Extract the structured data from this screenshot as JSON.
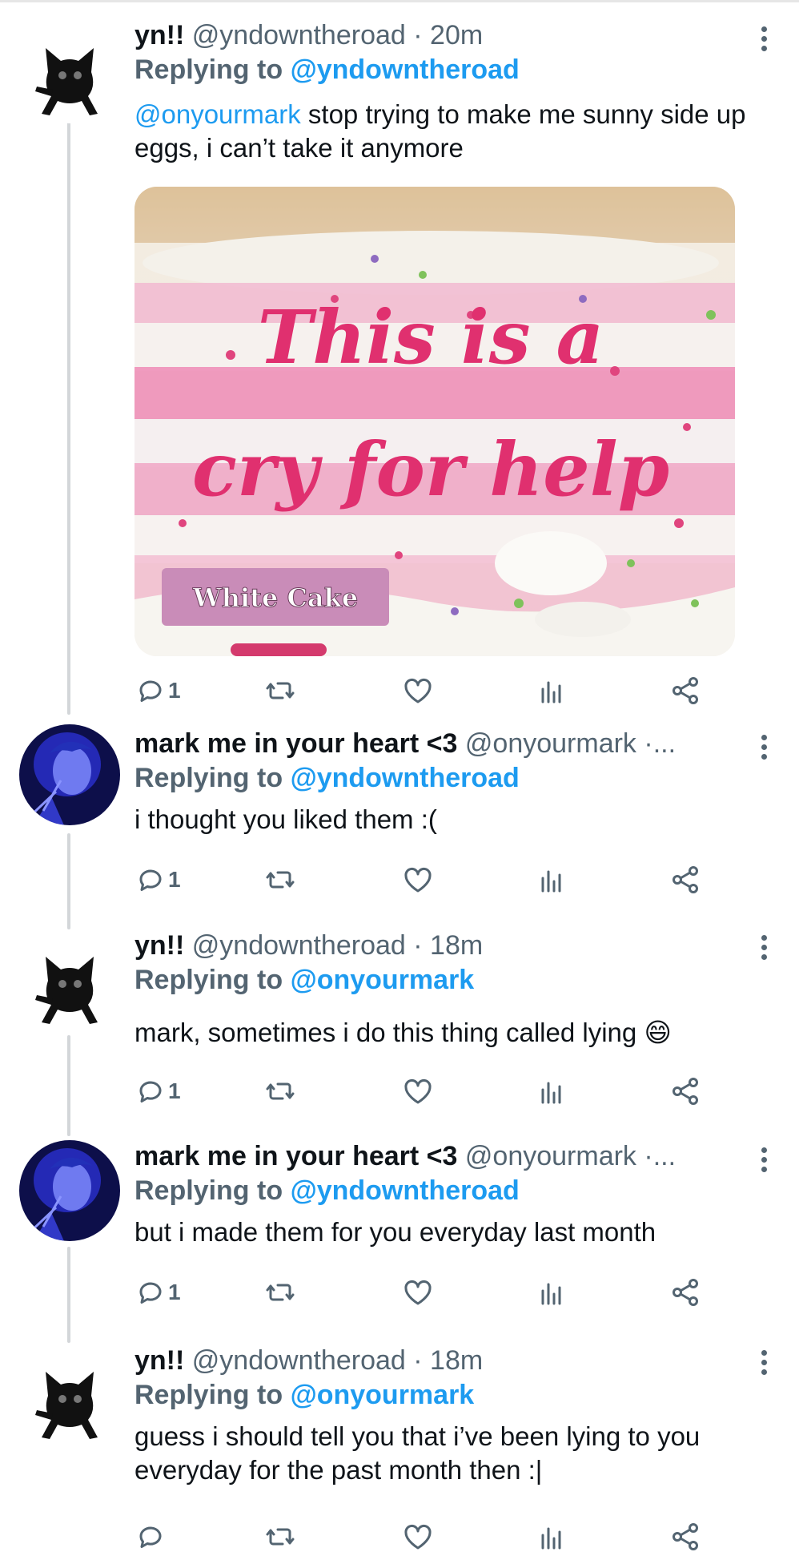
{
  "tweets": [
    {
      "name": "yn!!",
      "handle": "@yndowntheroad",
      "time": "20m",
      "replying_prefix": "Replying to",
      "replying_to": "@yndowntheroad",
      "mention": "@onyourmark",
      "text": " stop trying to make me sunny side up eggs, i can’t take it anymore",
      "reply_count": "1",
      "image": {
        "cake_text_line1": "This is a",
        "cake_text_line2": "cry for help",
        "label": "White Cake"
      },
      "avatar": "black-cat-avatar"
    },
    {
      "name": "mark me in your heart <3",
      "handle": "@onyourmark ·...",
      "replying_prefix": "Replying to",
      "replying_to": "@yndowntheroad",
      "text": "i thought you liked them :(",
      "reply_count": "1",
      "avatar": "blue-photo-avatar"
    },
    {
      "name": "yn!!",
      "handle": "@yndowntheroad",
      "time": "18m",
      "replying_prefix": "Replying to",
      "replying_to": "@onyourmark",
      "text": "mark, sometimes i do this thing called lying",
      "emoji": "😄",
      "reply_count": "1",
      "avatar": "black-cat-avatar"
    },
    {
      "name": "mark me in your heart <3",
      "handle": "@onyourmark ·...",
      "replying_prefix": "Replying to",
      "replying_to": "@yndowntheroad",
      "text": "but i made them for you everyday last month",
      "reply_count": "1",
      "avatar": "blue-photo-avatar"
    },
    {
      "name": "yn!!",
      "handle": "@yndowntheroad",
      "time": "18m",
      "replying_prefix": "Replying to",
      "replying_to": "@onyourmark",
      "text": "guess i should tell you that i’ve been lying to you everyday for the past month then :|",
      "avatar": "black-cat-avatar"
    }
  ],
  "colors": {
    "accent": "#1d9bf0",
    "muted": "#536471",
    "text": "#0f1419",
    "thread_line": "#d3d6d9"
  }
}
